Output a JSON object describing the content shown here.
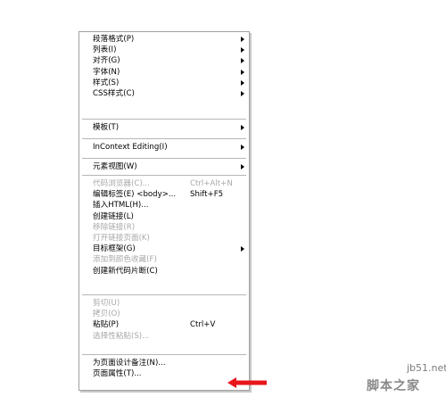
{
  "menu": {
    "groups": [
      [
        {
          "label": "段落格式(P)",
          "submenu": true,
          "disabled": false
        },
        {
          "label": "列表(I)",
          "submenu": true,
          "disabled": false
        },
        {
          "label": "对齐(G)",
          "submenu": true,
          "disabled": false
        },
        {
          "label": "字体(N)",
          "submenu": true,
          "disabled": false
        },
        {
          "label": "样式(S)",
          "submenu": true,
          "disabled": false
        },
        {
          "label": "CSS样式(C)",
          "submenu": true,
          "disabled": false
        }
      ],
      [
        {
          "label": "模板(T)",
          "submenu": true,
          "disabled": false
        }
      ],
      [
        {
          "label": "InContext Editing(I)",
          "submenu": true,
          "disabled": false
        }
      ],
      [
        {
          "label": "元素视图(W)",
          "submenu": true,
          "disabled": false
        }
      ],
      [
        {
          "label": "代码浏览器(C)...",
          "shortcut": "Ctrl+Alt+N",
          "disabled": true
        },
        {
          "label": "编辑标签(E) <body>...",
          "shortcut": "Shift+F5",
          "disabled": false
        },
        {
          "label": "插入HTML(H)...",
          "disabled": false
        },
        {
          "label": "创建链接(L)",
          "disabled": false
        },
        {
          "label": "移除链接(R)",
          "disabled": true
        },
        {
          "label": "打开链接页面(K)",
          "disabled": true
        },
        {
          "label": "目标框架(G)",
          "submenu": true,
          "disabled": false
        },
        {
          "label": "添加到颜色收藏(F)",
          "disabled": true
        },
        {
          "label": "创建新代码片断(C)",
          "disabled": false
        }
      ],
      [
        {
          "label": "剪切(U)",
          "disabled": true
        },
        {
          "label": "拷贝(O)",
          "disabled": true
        },
        {
          "label": "粘贴(P)",
          "shortcut": "Ctrl+V",
          "disabled": false
        },
        {
          "label": "选择性粘贴(S)...",
          "disabled": true
        }
      ],
      [
        {
          "label": "为页面设计备注(N)...",
          "disabled": false
        },
        {
          "label": "页面属性(T)...",
          "disabled": false
        }
      ]
    ]
  },
  "annotation": {
    "arrow_color": "#e8151b"
  },
  "watermark": {
    "url": "jb51.net",
    "text": "脚本之家"
  }
}
